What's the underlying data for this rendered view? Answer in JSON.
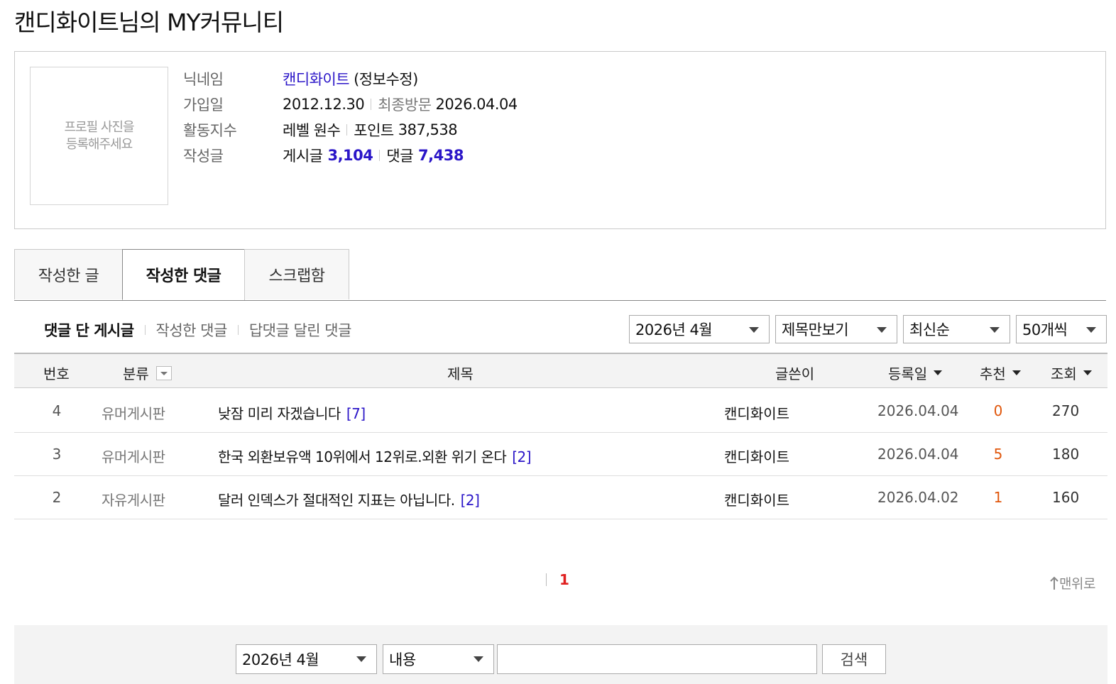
{
  "page": {
    "title": "캔디화이트님의 MY커뮤니티"
  },
  "profile": {
    "photo_placeholder_line1": "프로필 사진을",
    "photo_placeholder_line2": "등록해주세요",
    "labels": {
      "nickname": "닉네임",
      "joined": "가입일",
      "activity": "활동지수",
      "written": "작성글"
    },
    "nickname": "캔디화이트",
    "edit_link": "(정보수정)",
    "join_date": "2012.12.30",
    "last_visit_label": "최종방문",
    "last_visit": "2026.04.04",
    "level_label": "레벨",
    "level": "원수",
    "point_label": "포인트",
    "points": "387,538",
    "posts_label": "게시글",
    "posts": "3,104",
    "comments_label": "댓글",
    "comments": "7,438"
  },
  "tabs": [
    "작성한 글",
    "작성한 댓글",
    "스크랩함"
  ],
  "subnav": [
    "댓글 단 게시글",
    "작성한 댓글",
    "답댓글 달린 댓글"
  ],
  "filters": {
    "month": "2026년 4월",
    "view": "제목만보기",
    "sort": "최신순",
    "count": "50개씩"
  },
  "table": {
    "headers": {
      "no": "번호",
      "category": "분류",
      "title": "제목",
      "writer": "글쓴이",
      "date": "등록일",
      "recommend": "추천",
      "views": "조회"
    },
    "rows": [
      {
        "no": "4",
        "category": "유머게시판",
        "title": "낮잠 미리 자겠습니다",
        "comments": "[7]",
        "writer": "캔디화이트",
        "date": "2026.04.04",
        "recommend": "0",
        "views": "270"
      },
      {
        "no": "3",
        "category": "유머게시판",
        "title": "한국 외환보유액 10위에서 12위로.외환 위기 온다",
        "comments": "[2]",
        "writer": "캔디화이트",
        "date": "2026.04.04",
        "recommend": "5",
        "views": "180"
      },
      {
        "no": "2",
        "category": "자유게시판",
        "title": "달러 인덱스가 절대적인 지표는 아닙니다.",
        "comments": "[2]",
        "writer": "캔디화이트",
        "date": "2026.04.02",
        "recommend": "1",
        "views": "160"
      }
    ]
  },
  "pagination": {
    "current": "1"
  },
  "to_top": "맨위로",
  "search": {
    "month": "2026년 4월",
    "field": "내용",
    "query": "",
    "button": "검색"
  },
  "colors": {
    "link_blue": "#2b16c8",
    "recommend_orange": "#e0560b",
    "page_red": "#e02020"
  }
}
